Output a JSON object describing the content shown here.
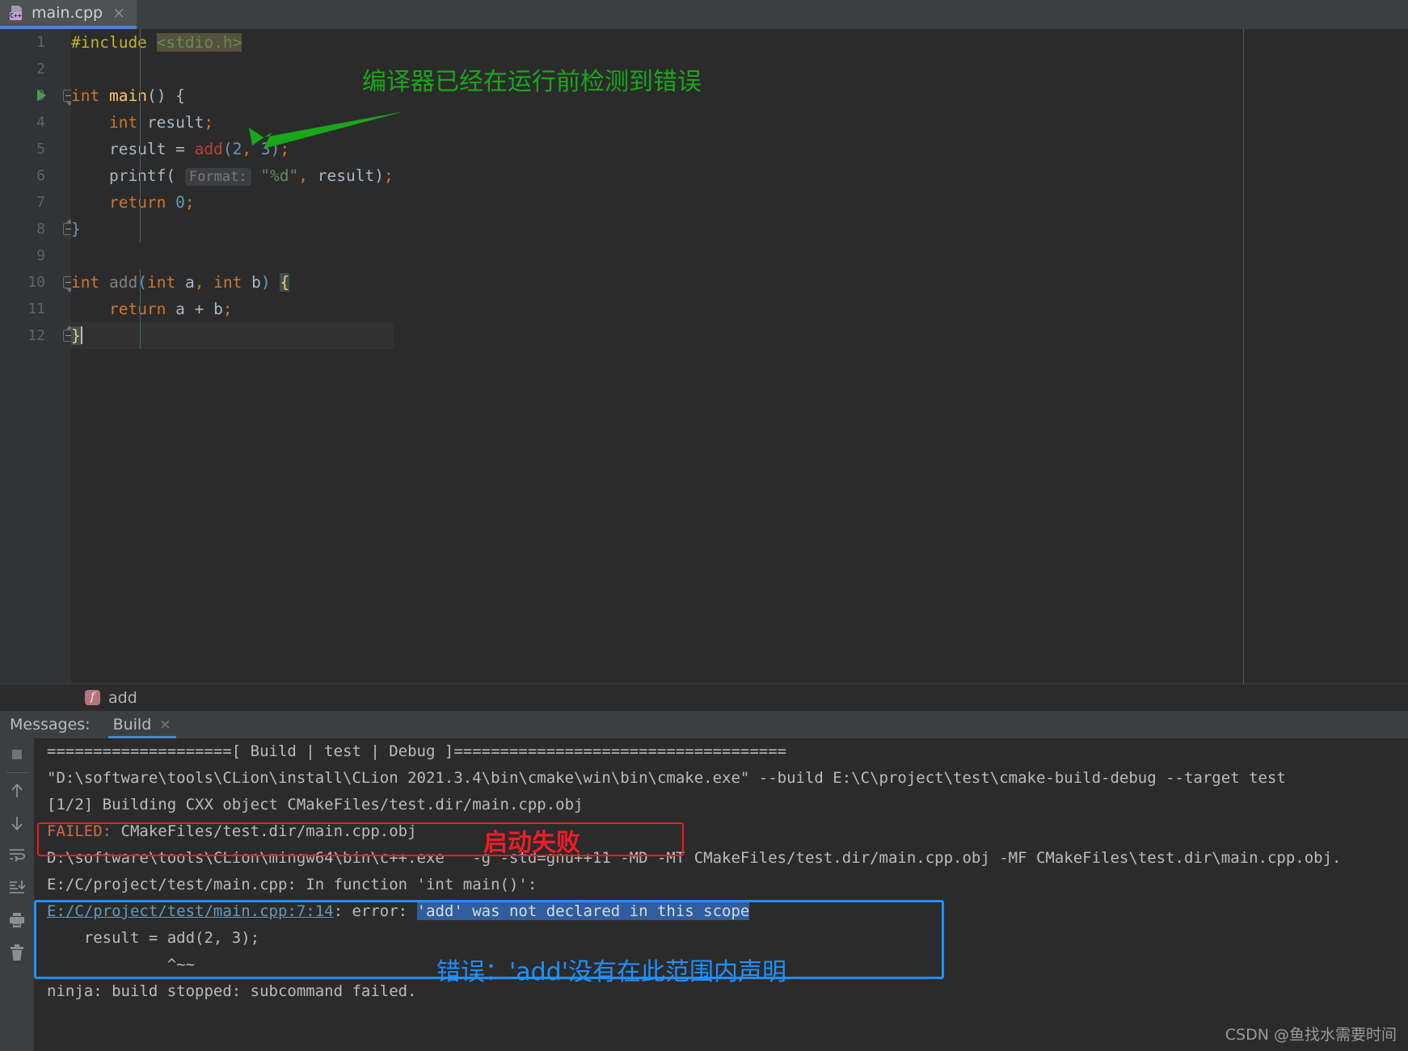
{
  "tab": {
    "filename": "main.cpp",
    "icon": "cpp-file-icon",
    "icon_label": "C++",
    "close": "×"
  },
  "editor": {
    "lines": [
      {
        "num": "1",
        "fold": null,
        "run": false,
        "tokens": [
          {
            "t": "#include ",
            "c": "t-pre"
          },
          {
            "t": "<stdio.h>",
            "c": "t-strhl"
          }
        ]
      },
      {
        "num": "2",
        "fold": null,
        "run": false,
        "tokens": []
      },
      {
        "num": "3",
        "fold": "open",
        "run": true,
        "tokens": [
          {
            "t": "int",
            "c": "t-kw"
          },
          {
            "t": " ",
            "c": "t-op"
          },
          {
            "t": "main",
            "c": "t-fn"
          },
          {
            "t": "() {",
            "c": "t-id"
          }
        ]
      },
      {
        "num": "4",
        "fold": null,
        "run": false,
        "tokens": [
          {
            "t": "    ",
            "c": "t-op"
          },
          {
            "t": "int",
            "c": "t-kw"
          },
          {
            "t": " result",
            "c": "t-id"
          },
          {
            "t": ";",
            "c": "t-semi"
          }
        ]
      },
      {
        "num": "5",
        "fold": null,
        "run": false,
        "tokens": [
          {
            "t": "    result ",
            "c": "t-id"
          },
          {
            "t": "=",
            "c": "t-op"
          },
          {
            "t": " ",
            "c": "t-op"
          },
          {
            "t": "add",
            "c": "t-err"
          },
          {
            "t": "(",
            "c": "t-num"
          },
          {
            "t": "2",
            "c": "t-num"
          },
          {
            "t": ",",
            "c": "t-semi"
          },
          {
            "t": " ",
            "c": "t-op"
          },
          {
            "t": "3",
            "c": "t-num"
          },
          {
            "t": ")",
            "c": "t-num"
          },
          {
            "t": ";",
            "c": "t-semi"
          }
        ]
      },
      {
        "num": "6",
        "fold": null,
        "run": false,
        "tokens": [
          {
            "t": "    printf(",
            "c": "t-id"
          },
          {
            "t": " ",
            "c": "t-op"
          },
          {
            "t": "Format:",
            "c": "hint"
          },
          {
            "t": " ",
            "c": "t-op"
          },
          {
            "t": "\"%d\"",
            "c": "t-str"
          },
          {
            "t": ",",
            "c": "t-semi"
          },
          {
            "t": " result)",
            "c": "t-id"
          },
          {
            "t": ";",
            "c": "t-semi"
          }
        ]
      },
      {
        "num": "7",
        "fold": null,
        "run": false,
        "tokens": [
          {
            "t": "    ",
            "c": "t-op"
          },
          {
            "t": "return",
            "c": "t-kw"
          },
          {
            "t": " ",
            "c": "t-op"
          },
          {
            "t": "0",
            "c": "t-num"
          },
          {
            "t": ";",
            "c": "t-semi"
          }
        ]
      },
      {
        "num": "8",
        "fold": "close",
        "run": false,
        "tokens": [
          {
            "t": "}",
            "c": "t-num"
          }
        ]
      },
      {
        "num": "9",
        "fold": null,
        "run": false,
        "tokens": []
      },
      {
        "num": "10",
        "fold": "open",
        "run": false,
        "tokens": [
          {
            "t": "int",
            "c": "t-kw"
          },
          {
            "t": " ",
            "c": "t-op"
          },
          {
            "t": "add",
            "c": "t-dim"
          },
          {
            "t": "(",
            "c": "t-num"
          },
          {
            "t": "int",
            "c": "t-kw"
          },
          {
            "t": " a",
            "c": "t-id"
          },
          {
            "t": ",",
            "c": "t-semi"
          },
          {
            "t": " ",
            "c": "t-op"
          },
          {
            "t": "int",
            "c": "t-kw"
          },
          {
            "t": " b",
            "c": "t-id"
          },
          {
            "t": ")",
            "c": "t-num"
          },
          {
            "t": " ",
            "c": "t-op"
          },
          {
            "t": "{",
            "c": "brace-hl"
          }
        ]
      },
      {
        "num": "11",
        "fold": null,
        "run": false,
        "tokens": [
          {
            "t": "    ",
            "c": "t-op"
          },
          {
            "t": "return",
            "c": "t-kw"
          },
          {
            "t": " a ",
            "c": "t-id"
          },
          {
            "t": "+",
            "c": "t-op"
          },
          {
            "t": " b",
            "c": "t-id"
          },
          {
            "t": ";",
            "c": "t-semi"
          }
        ]
      },
      {
        "num": "12",
        "fold": "close",
        "run": false,
        "current": true,
        "caret": true,
        "tokens": [
          {
            "t": "}",
            "c": "brace-hl"
          }
        ]
      }
    ]
  },
  "annotations": {
    "green_note": "编译器已经在运行前检测到错误",
    "green_color": "#17a81a",
    "red_note": "启动失败",
    "red_color": "#ee1c25",
    "blue_note": "错误：'add'没有在此范围内声明",
    "blue_color": "#1e90ff"
  },
  "breadcrumb": {
    "icon": "function-icon",
    "icon_letter": "f",
    "label": "add"
  },
  "messages_panel": {
    "title": "Messages:",
    "tab_label": "Build",
    "tab_close": "×",
    "toolbar_icons": [
      "stop-icon",
      "separator",
      "arrow-up-icon",
      "arrow-down-icon",
      "soft-wrap-icon",
      "scroll-to-end-icon",
      "print-icon",
      "trash-icon"
    ],
    "console_lines": [
      {
        "segments": [
          {
            "t": "====================[ Build | test | Debug ]====================================",
            "c": ""
          }
        ]
      },
      {
        "segments": [
          {
            "t": "\"D:\\software\\tools\\CLion\\install\\CLion 2021.3.4\\bin\\cmake\\win\\bin\\cmake.exe\" --build E:\\C\\project\\test\\cmake-build-debug --target test",
            "c": ""
          }
        ]
      },
      {
        "segments": [
          {
            "t": "[1/2] Building CXX object CMakeFiles/test.dir/main.cpp.obj",
            "c": ""
          }
        ]
      },
      {
        "segments": [
          {
            "t": "FAILED: ",
            "c": "c-failed"
          },
          {
            "t": "CMakeFiles/test.dir/main.cpp.obj",
            "c": ""
          }
        ]
      },
      {
        "segments": [
          {
            "t": "D:\\software\\tools\\CLion\\mingw64\\bin\\c++.exe   -g -std=gnu++11 -MD -MT CMakeFiles/test.dir/main.cpp.obj -MF CMakeFiles\\test.dir\\main.cpp.obj.",
            "c": ""
          }
        ]
      },
      {
        "segments": [
          {
            "t": "E:/C/project/test/main.cpp: In function 'int main()':",
            "c": ""
          }
        ]
      },
      {
        "segments": [
          {
            "t": "E:/C/project/test/main.cpp:7:14",
            "c": "c-link"
          },
          {
            "t": ": error: ",
            "c": ""
          },
          {
            "t": "'add' was not declared in this scope",
            "c": "c-sel"
          }
        ]
      },
      {
        "segments": [
          {
            "t": "    result = add(2, 3);",
            "c": ""
          }
        ]
      },
      {
        "segments": [
          {
            "t": "             ^~~",
            "c": ""
          }
        ]
      },
      {
        "segments": [
          {
            "t": "ninja: build stopped: subcommand failed.",
            "c": ""
          }
        ]
      }
    ]
  },
  "watermark": "CSDN @鱼找水需要时间"
}
